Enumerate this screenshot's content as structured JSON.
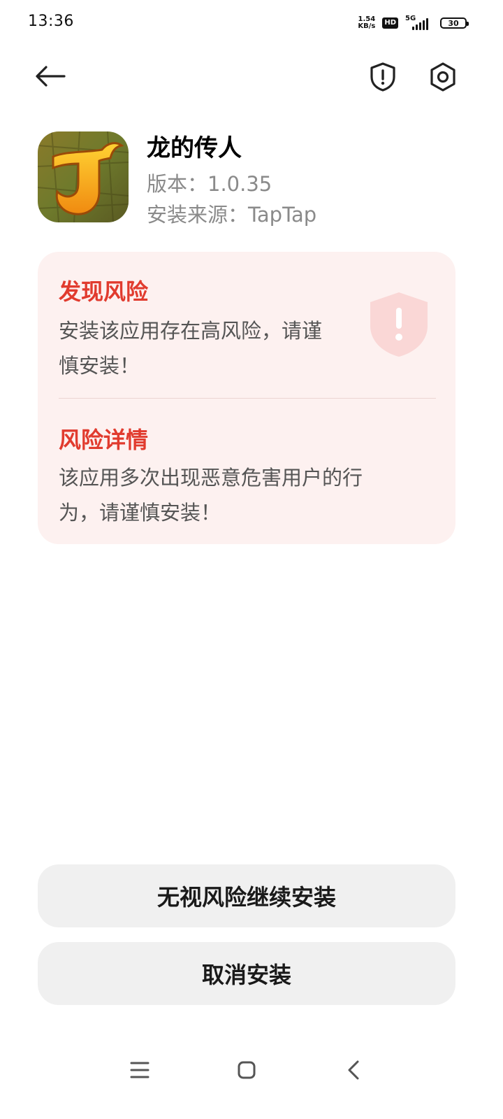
{
  "status_bar": {
    "time": "13:36",
    "net_speed_value": "1.54",
    "net_speed_unit": "KB/s",
    "hd_label": "HD",
    "network_label": "5G",
    "battery": "30"
  },
  "nav": {
    "back_icon": "arrow-left-icon",
    "shield_icon": "shield-alert-icon",
    "settings_icon": "gear-icon"
  },
  "app": {
    "name": "龙的传人",
    "version": "版本：1.0.35",
    "source": "安装来源：TapTap"
  },
  "risk": {
    "found_title": "发现风险",
    "found_text_line1": "安装该应用存在高风险，请谨",
    "found_text_line2": "慎安装！",
    "detail_title": "风险详情",
    "detail_text_line1": "该应用多次出现恶意危害用户的行",
    "detail_text_line2": "为，请谨慎安装！",
    "accent_color": "#e13b2e",
    "card_color": "#fdf1f0"
  },
  "actions": {
    "ignore_install": "无视风险继续安装",
    "cancel_install": "取消安装"
  },
  "system_nav": {
    "menu_icon": "menu-icon",
    "home_icon": "home-square-icon",
    "back_icon": "chevron-left-icon"
  }
}
